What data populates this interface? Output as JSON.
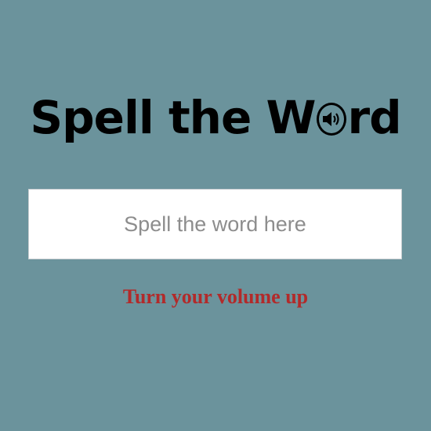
{
  "header": {
    "title_prefix": "Spell the W",
    "title_suffix": "rd",
    "speaker_icon": "speaker-volume-icon"
  },
  "input": {
    "placeholder": "Spell the word here",
    "value": ""
  },
  "hint": {
    "text": "Turn your volume up",
    "color": "#b22a2a"
  },
  "colors": {
    "background": "#6b939c",
    "input_background": "#ffffff",
    "title": "#000000"
  }
}
